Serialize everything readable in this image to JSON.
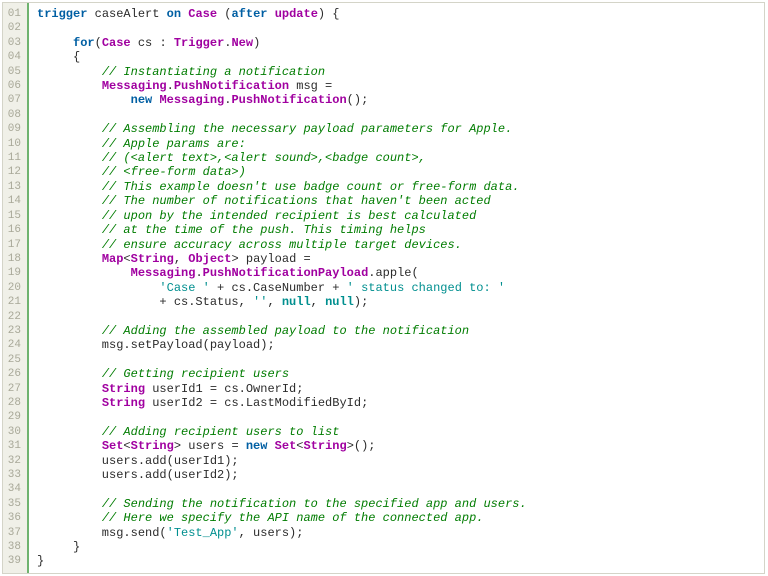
{
  "chart_data": {
    "type": "table",
    "title": "Apex trigger code listing (caseAlert on Case, after update)"
  },
  "editor": {
    "lineNumbers": [
      "01",
      "02",
      "03",
      "04",
      "05",
      "06",
      "07",
      "08",
      "09",
      "10",
      "11",
      "12",
      "13",
      "14",
      "15",
      "16",
      "17",
      "18",
      "19",
      "20",
      "21",
      "22",
      "23",
      "24",
      "25",
      "26",
      "27",
      "28",
      "29",
      "30",
      "31",
      "32",
      "33",
      "34",
      "35",
      "36",
      "37",
      "38",
      "39"
    ],
    "code": {
      "l01": {
        "t": [
          {
            "c": "kw",
            "v": "trigger"
          },
          {
            "v": " caseAlert "
          },
          {
            "c": "kw",
            "v": "on"
          },
          {
            "v": " "
          },
          {
            "c": "ty",
            "v": "Case"
          },
          {
            "v": " ("
          },
          {
            "c": "kw",
            "v": "after"
          },
          {
            "v": " "
          },
          {
            "c": "up",
            "v": "update"
          },
          {
            "v": ") {"
          }
        ]
      },
      "l02": {
        "t": [
          {
            "v": " "
          }
        ]
      },
      "l03": {
        "t": [
          {
            "v": "     "
          },
          {
            "c": "kw",
            "v": "for"
          },
          {
            "v": "("
          },
          {
            "c": "ty",
            "v": "Case"
          },
          {
            "v": " cs : "
          },
          {
            "c": "ty",
            "v": "Trigger"
          },
          {
            "v": "."
          },
          {
            "c": "ty",
            "v": "New"
          },
          {
            "v": ")"
          }
        ]
      },
      "l04": {
        "t": [
          {
            "v": "     {"
          }
        ]
      },
      "l05": {
        "t": [
          {
            "v": "         "
          },
          {
            "c": "cm",
            "v": "// Instantiating a notification"
          }
        ]
      },
      "l06": {
        "t": [
          {
            "v": "         "
          },
          {
            "c": "ty",
            "v": "Messaging"
          },
          {
            "v": "."
          },
          {
            "c": "ty",
            "v": "PushNotification"
          },
          {
            "v": " msg ="
          }
        ]
      },
      "l07": {
        "t": [
          {
            "v": "             "
          },
          {
            "c": "kw",
            "v": "new"
          },
          {
            "v": " "
          },
          {
            "c": "ty",
            "v": "Messaging"
          },
          {
            "v": "."
          },
          {
            "c": "ty",
            "v": "PushNotification"
          },
          {
            "v": "();"
          }
        ]
      },
      "l08": {
        "t": [
          {
            "v": " "
          }
        ]
      },
      "l09": {
        "t": [
          {
            "v": "         "
          },
          {
            "c": "cm",
            "v": "// Assembling the necessary payload parameters for Apple."
          }
        ]
      },
      "l10": {
        "t": [
          {
            "v": "         "
          },
          {
            "c": "cm",
            "v": "// Apple params are:"
          }
        ]
      },
      "l11": {
        "t": [
          {
            "v": "         "
          },
          {
            "c": "cm",
            "v": "// (<alert text>,<alert sound>,<badge count>,"
          }
        ]
      },
      "l12": {
        "t": [
          {
            "v": "         "
          },
          {
            "c": "cm",
            "v": "// <free-form data>)"
          }
        ]
      },
      "l13": {
        "t": [
          {
            "v": "         "
          },
          {
            "c": "cm",
            "v": "// This example doesn't use badge count or free-form data."
          }
        ]
      },
      "l14": {
        "t": [
          {
            "v": "         "
          },
          {
            "c": "cm",
            "v": "// The number of notifications that haven't been acted"
          }
        ]
      },
      "l15": {
        "t": [
          {
            "v": "         "
          },
          {
            "c": "cm",
            "v": "// upon by the intended recipient is best calculated"
          }
        ]
      },
      "l16": {
        "t": [
          {
            "v": "         "
          },
          {
            "c": "cm",
            "v": "// at the time of the push. This timing helps"
          }
        ]
      },
      "l17": {
        "t": [
          {
            "v": "         "
          },
          {
            "c": "cm",
            "v": "// ensure accuracy across multiple target devices."
          }
        ]
      },
      "l18": {
        "t": [
          {
            "v": "         "
          },
          {
            "c": "ty",
            "v": "Map"
          },
          {
            "v": "<"
          },
          {
            "c": "ty",
            "v": "String"
          },
          {
            "v": ", "
          },
          {
            "c": "ty",
            "v": "Object"
          },
          {
            "v": "> payload ="
          }
        ]
      },
      "l19": {
        "t": [
          {
            "v": "             "
          },
          {
            "c": "ty",
            "v": "Messaging"
          },
          {
            "v": "."
          },
          {
            "c": "ty",
            "v": "PushNotificationPayload"
          },
          {
            "v": ".apple("
          }
        ]
      },
      "l20": {
        "t": [
          {
            "v": "                 "
          },
          {
            "c": "st",
            "v": "'Case '"
          },
          {
            "v": " + cs.CaseNumber + "
          },
          {
            "c": "st",
            "v": "' status changed to: '"
          }
        ]
      },
      "l21": {
        "t": [
          {
            "v": "                 + cs.Status, "
          },
          {
            "c": "st",
            "v": "''"
          },
          {
            "v": ", "
          },
          {
            "c": "pn",
            "v": "null"
          },
          {
            "v": ", "
          },
          {
            "c": "pn",
            "v": "null"
          },
          {
            "v": ");"
          }
        ]
      },
      "l22": {
        "t": [
          {
            "v": " "
          }
        ]
      },
      "l23": {
        "t": [
          {
            "v": "         "
          },
          {
            "c": "cm",
            "v": "// Adding the assembled payload to the notification"
          }
        ]
      },
      "l24": {
        "t": [
          {
            "v": "         msg.setPayload(payload);"
          }
        ]
      },
      "l25": {
        "t": [
          {
            "v": " "
          }
        ]
      },
      "l26": {
        "t": [
          {
            "v": "         "
          },
          {
            "c": "cm",
            "v": "// Getting recipient users"
          }
        ]
      },
      "l27": {
        "t": [
          {
            "v": "         "
          },
          {
            "c": "ty",
            "v": "String"
          },
          {
            "v": " userId1 = cs.OwnerId;"
          }
        ]
      },
      "l28": {
        "t": [
          {
            "v": "         "
          },
          {
            "c": "ty",
            "v": "String"
          },
          {
            "v": " userId2 = cs.LastModifiedById;"
          }
        ]
      },
      "l29": {
        "t": [
          {
            "v": " "
          }
        ]
      },
      "l30": {
        "t": [
          {
            "v": "         "
          },
          {
            "c": "cm",
            "v": "// Adding recipient users to list"
          }
        ]
      },
      "l31": {
        "t": [
          {
            "v": "         "
          },
          {
            "c": "ty",
            "v": "Set"
          },
          {
            "v": "<"
          },
          {
            "c": "ty",
            "v": "String"
          },
          {
            "v": "> users = "
          },
          {
            "c": "kw",
            "v": "new"
          },
          {
            "v": " "
          },
          {
            "c": "ty",
            "v": "Set"
          },
          {
            "v": "<"
          },
          {
            "c": "ty",
            "v": "String"
          },
          {
            "v": ">();"
          }
        ]
      },
      "l32": {
        "t": [
          {
            "v": "         users.add(userId1);"
          }
        ]
      },
      "l33": {
        "t": [
          {
            "v": "         users.add(userId2);"
          }
        ]
      },
      "l34": {
        "t": [
          {
            "v": " "
          }
        ]
      },
      "l35": {
        "t": [
          {
            "v": "         "
          },
          {
            "c": "cm",
            "v": "// Sending the notification to the specified app and users."
          }
        ]
      },
      "l36": {
        "t": [
          {
            "v": "         "
          },
          {
            "c": "cm",
            "v": "// Here we specify the API name of the connected app."
          }
        ]
      },
      "l37": {
        "t": [
          {
            "v": "         msg.send("
          },
          {
            "c": "st",
            "v": "'Test_App'"
          },
          {
            "v": ", users);"
          }
        ]
      },
      "l38": {
        "t": [
          {
            "v": "     }"
          }
        ]
      },
      "l39": {
        "t": [
          {
            "v": "}"
          }
        ]
      }
    }
  }
}
